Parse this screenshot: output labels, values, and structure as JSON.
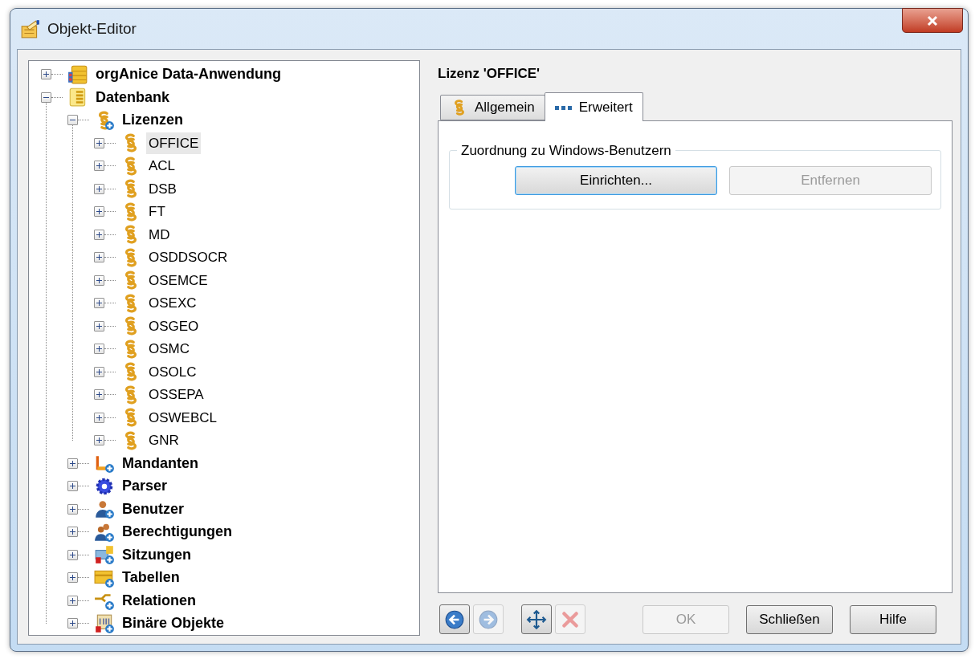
{
  "window": {
    "title": "Objekt-Editor"
  },
  "tree": [
    {
      "label": "orgAnice Data-Anwendung",
      "kind": "application",
      "expanded": false,
      "selected": false
    },
    {
      "label": "Datenbank",
      "kind": "database",
      "expanded": true,
      "selected": false,
      "children": [
        {
          "label": "Lizenzen",
          "kind": "license-group",
          "expanded": true,
          "selected": false,
          "children": [
            {
              "label": "OFFICE",
              "kind": "license",
              "expanded": false,
              "selected": true
            },
            {
              "label": "ACL",
              "kind": "license",
              "expanded": false,
              "selected": false
            },
            {
              "label": "DSB",
              "kind": "license",
              "expanded": false,
              "selected": false
            },
            {
              "label": "FT",
              "kind": "license",
              "expanded": false,
              "selected": false
            },
            {
              "label": "MD",
              "kind": "license",
              "expanded": false,
              "selected": false
            },
            {
              "label": "OSDDSOCR",
              "kind": "license",
              "expanded": false,
              "selected": false
            },
            {
              "label": "OSEMCE",
              "kind": "license",
              "expanded": false,
              "selected": false
            },
            {
              "label": "OSEXC",
              "kind": "license",
              "expanded": false,
              "selected": false
            },
            {
              "label": "OSGEO",
              "kind": "license",
              "expanded": false,
              "selected": false
            },
            {
              "label": "OSMC",
              "kind": "license",
              "expanded": false,
              "selected": false
            },
            {
              "label": "OSOLC",
              "kind": "license",
              "expanded": false,
              "selected": false
            },
            {
              "label": "OSSEPA",
              "kind": "license",
              "expanded": false,
              "selected": false
            },
            {
              "label": "OSWEBCL",
              "kind": "license",
              "expanded": false,
              "selected": false
            },
            {
              "label": "GNR",
              "kind": "license",
              "expanded": false,
              "selected": false
            }
          ]
        },
        {
          "label": "Mandanten",
          "kind": "clients",
          "expanded": false,
          "selected": false
        },
        {
          "label": "Parser",
          "kind": "parser",
          "expanded": false,
          "selected": false
        },
        {
          "label": "Benutzer",
          "kind": "user",
          "expanded": false,
          "selected": false
        },
        {
          "label": "Berechtigungen",
          "kind": "permissions",
          "expanded": false,
          "selected": false
        },
        {
          "label": "Sitzungen",
          "kind": "sessions",
          "expanded": false,
          "selected": false
        },
        {
          "label": "Tabellen",
          "kind": "tables",
          "expanded": false,
          "selected": false
        },
        {
          "label": "Relationen",
          "kind": "relations",
          "expanded": false,
          "selected": false
        },
        {
          "label": "Binäre Objekte",
          "kind": "binary",
          "expanded": false,
          "selected": false
        }
      ]
    }
  ],
  "detail": {
    "title": "Lizenz 'OFFICE'",
    "tabs": [
      {
        "label": "Allgemein",
        "kind": "license",
        "selected": false
      },
      {
        "label": "Erweitert",
        "kind": "dots",
        "selected": true
      }
    ],
    "group": {
      "title": "Zuordnung zu Windows-Benutzern",
      "buttons": [
        {
          "label": "Einrichten...",
          "disabled": false,
          "focused": true
        },
        {
          "label": "Entfernen",
          "disabled": true,
          "focused": false
        }
      ]
    }
  },
  "toolbar": [
    {
      "kind": "back",
      "disabled": false
    },
    {
      "kind": "forward",
      "disabled": true
    },
    {
      "kind": "move",
      "disabled": false
    },
    {
      "kind": "delete",
      "disabled": true
    }
  ],
  "buttons": [
    {
      "label": "OK",
      "disabled": true
    },
    {
      "label": "Schließen",
      "disabled": false
    },
    {
      "label": "Hilfe",
      "disabled": false
    }
  ]
}
